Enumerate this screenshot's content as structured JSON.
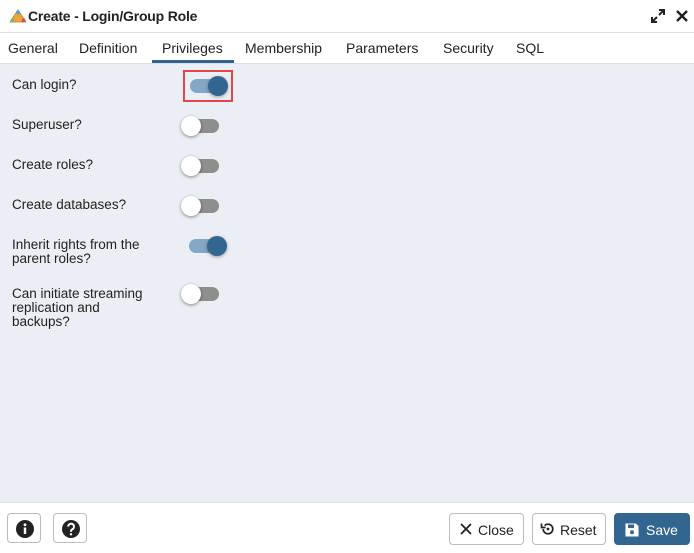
{
  "window": {
    "title": "Create - Login/Group Role",
    "title_icon": "pgadmin-role-icon",
    "controls": {
      "expand_icon": "expand-icon",
      "close_icon": "close-icon"
    }
  },
  "tabs": [
    {
      "label": "General",
      "active": false
    },
    {
      "label": "Definition",
      "active": false
    },
    {
      "label": "Privileges",
      "active": true
    },
    {
      "label": "Membership",
      "active": false
    },
    {
      "label": "Parameters",
      "active": false
    },
    {
      "label": "Security",
      "active": false
    },
    {
      "label": "SQL",
      "active": false
    }
  ],
  "privileges": [
    {
      "label": "Can login?",
      "on": true,
      "highlighted": true
    },
    {
      "label": "Superuser?",
      "on": false
    },
    {
      "label": "Create roles?",
      "on": false
    },
    {
      "label": "Create databases?",
      "on": false
    },
    {
      "label": "Inherit rights from the parent roles?",
      "label_lines": [
        "Inherit rights from the",
        "parent roles?"
      ],
      "on": true
    },
    {
      "label": "Can initiate streaming replication and backups?",
      "label_lines": [
        "Can initiate streaming",
        "replication and",
        "backups?"
      ],
      "on": false
    }
  ],
  "footer": {
    "info_icon": "info-icon",
    "help_icon": "help-icon",
    "close_label": "Close",
    "reset_label": "Reset",
    "save_label": "Save"
  },
  "colors": {
    "accent": "#326690",
    "toggle_on_track": "#84a7c7",
    "toggle_off_track": "#8e8e8e",
    "content_bg": "#ebeef4",
    "highlight": "#e24747"
  }
}
